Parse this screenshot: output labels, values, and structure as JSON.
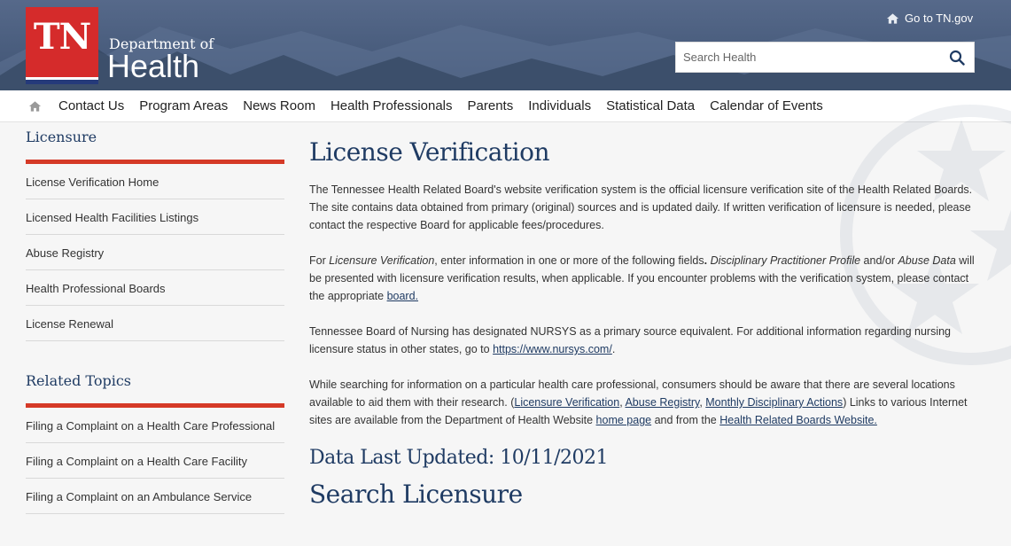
{
  "header": {
    "logo_text": "TN",
    "dept_small": "Department of",
    "dept_big": "Health",
    "goto_label": "Go to TN.gov",
    "search_placeholder": "Search Health"
  },
  "nav": {
    "items": [
      "Contact Us",
      "Program Areas",
      "News Room",
      "Health Professionals",
      "Parents",
      "Individuals",
      "Statistical Data",
      "Calendar of Events"
    ]
  },
  "sidebar": {
    "licensure_heading": "Licensure",
    "licensure_items": [
      "License Verification Home",
      "Licensed Health Facilities Listings",
      "Abuse Registry",
      "Health Professional Boards",
      "License Renewal"
    ],
    "related_heading": "Related Topics",
    "related_items": [
      "Filing a Complaint on a Health Care Professional",
      "Filing a Complaint on a Health Care Facility",
      "Filing a Complaint on an Ambulance Service"
    ]
  },
  "main": {
    "title": "License Verification",
    "p1": "The Tennessee Health Related Board's website verification system is the official licensure verification site of the Health Related Boards. The site contains data obtained from primary (original) sources and is updated daily. If written verification of licensure is needed, please contact the respective Board for applicable fees/procedures.",
    "p2_a": "For ",
    "p2_i1": "Licensure Verification",
    "p2_b": ", enter information in one or more of the following fields",
    "p2_dot": ".",
    "p2_i2": " Disciplinary Practitioner Profile",
    "p2_c": " and/or ",
    "p2_i3": "Abuse Data",
    "p2_d": " will be presented with licensure verification results, when applicable. If you encounter problems with the verification system, please contact the appropriate ",
    "p2_link": "board.",
    "p3_a": "Tennessee Board of Nursing has designated NURSYS as a primary source equivalent. For additional information regarding nursing licensure status in other states, go to ",
    "p3_link": "https://www.nursys.com/",
    "p3_b": ".",
    "p4_a": "While searching for information on a particular health care professional, consumers should be aware that there are several locations available to aid them with their research. (",
    "p4_l1": "Licensure Verification",
    "p4_s1": ", ",
    "p4_l2": "Abuse Registry",
    "p4_s2": ", ",
    "p4_l3": "Monthly Disciplinary Actions",
    "p4_b": ") Links to various Internet sites are available from the Department of Health Website ",
    "p4_l4": "home page",
    "p4_c": " and from the ",
    "p4_l5": "Health Related Boards Website.",
    "updated": "Data Last Updated: 10/11/2021",
    "search_heading": "Search Licensure"
  },
  "colors": {
    "header_bg": "#4a5f7d",
    "logo_red": "#d52b2b",
    "accent_red": "#d53a27",
    "heading_blue": "#1f3b63"
  },
  "icons": [
    "home-icon",
    "search-icon",
    "tennessee-stars-watermark"
  ]
}
